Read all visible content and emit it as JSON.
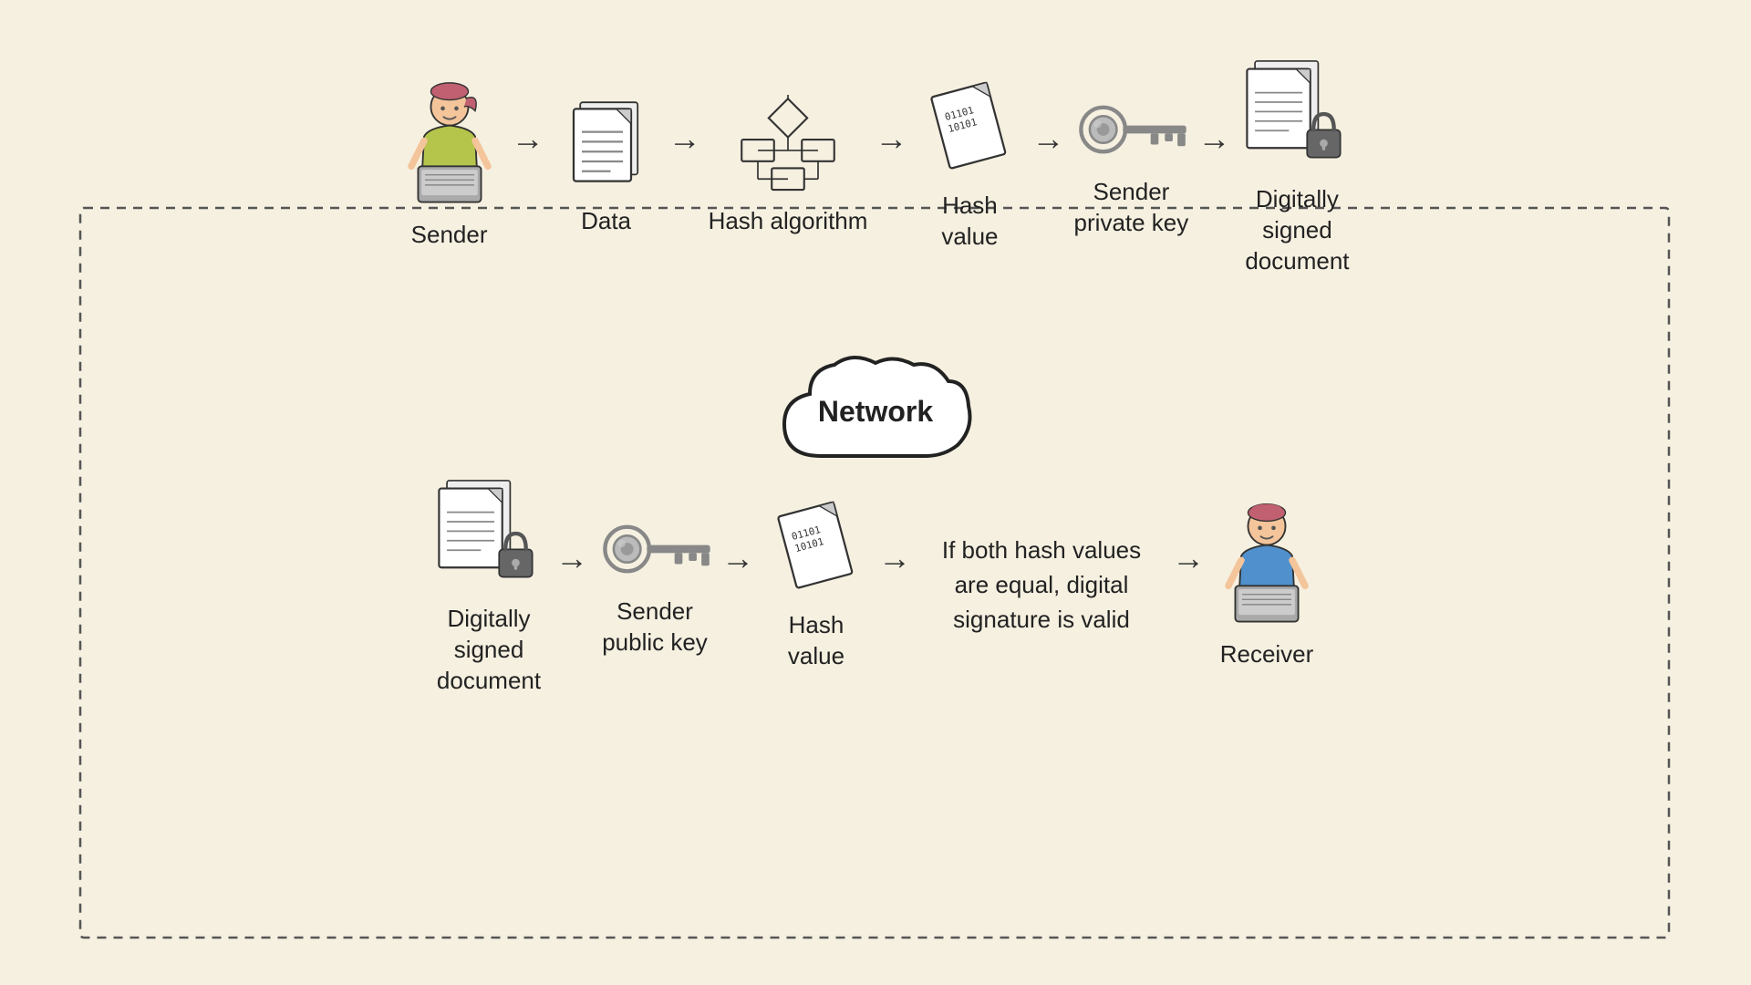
{
  "bg_color": "#f5f0e0",
  "top_row": {
    "nodes": [
      {
        "id": "sender",
        "label": "Sender"
      },
      {
        "id": "data",
        "label": "Data"
      },
      {
        "id": "hash_algorithm",
        "label": "Hash algorithm"
      },
      {
        "id": "hash_value_top",
        "label": "Hash\nvalue"
      },
      {
        "id": "sender_private_key",
        "label": "Sender\nprivate key"
      },
      {
        "id": "digitally_signed_doc_top",
        "label": "Digitally\nsigned\ndocument"
      }
    ]
  },
  "network_label": "Network",
  "bottom_row": {
    "nodes": [
      {
        "id": "digitally_signed_doc_bottom",
        "label": "Digitally\nsigned\ndocument"
      },
      {
        "id": "sender_public_key",
        "label": "Sender\npublic key"
      },
      {
        "id": "hash_value_bottom",
        "label": "Hash\nvalue"
      },
      {
        "id": "validation",
        "label": "If both hash values\nare equal, digital\nsignature is valid"
      },
      {
        "id": "receiver",
        "label": "Receiver"
      }
    ]
  }
}
